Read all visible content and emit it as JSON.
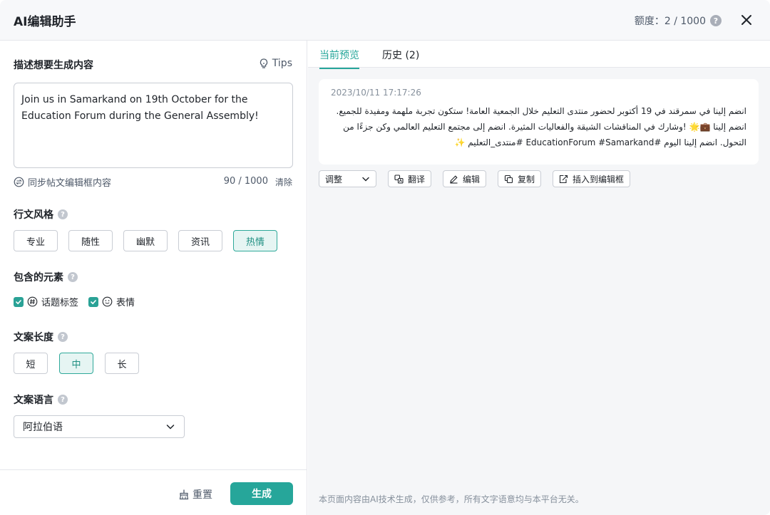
{
  "header": {
    "title": "AI编辑助手",
    "quota": "额度：2 / 1000"
  },
  "left": {
    "describe_label": "描述想要生成内容",
    "tips_label": "Tips",
    "textarea_value": "Join us in Samarkand on 19th October for the Education Forum during the General Assembly!",
    "sync_label": "同步帖文编辑框内容",
    "char_count": "90 / 1000",
    "clear_label": "清除",
    "style_label": "行文风格",
    "styles": [
      "专业",
      "随性",
      "幽默",
      "资讯",
      "热情"
    ],
    "active_style": "热情",
    "elements_label": "包含的元素",
    "elements": [
      {
        "label": "话题标签",
        "checked": true
      },
      {
        "label": "表情",
        "checked": true
      }
    ],
    "length_label": "文案长度",
    "lengths": [
      "短",
      "中",
      "长"
    ],
    "active_length": "中",
    "language_label": "文案语言",
    "language_value": "阿拉伯语",
    "reset_label": "重置",
    "generate_label": "生成"
  },
  "right": {
    "tabs": [
      "当前预览",
      "历史 (2)"
    ],
    "active_tab": "当前预览",
    "card": {
      "timestamp": "2023/10/11 17:17:26",
      "text": "انضم إلينا في سمرقند في 19 أكتوبر لحضور منتدى التعليم خلال الجمعية العامة! ستكون تجربة ملهمة ومفيدة للجميع. انضم إلينا 💼🌟 !وشارك في المناقشات الشيقة والفعاليات المثيرة. انضم إلى مجتمع التعليم العالمي وكن جزءًا من التحول. انضم إلينا اليوم #EducationForum #Samarkand #منتدى_التعليم ✨"
    },
    "actions": [
      "调整",
      "翻译",
      "编辑",
      "复制",
      "插入到编辑框"
    ],
    "disclaimer": "本页面内容由AI技术生成，仅供参考，所有文字语意均与本平台无关。"
  },
  "colors": {
    "accent": "#26a69a",
    "accent_light": "#e6f5f3"
  }
}
